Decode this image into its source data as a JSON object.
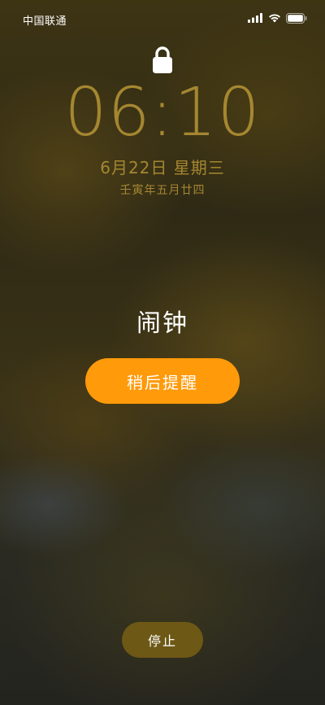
{
  "status_bar": {
    "carrier": "中国联通",
    "icons": [
      "signal-icon",
      "wifi-icon",
      "battery-icon"
    ]
  },
  "lock_screen": {
    "lock_icon": "lock-icon",
    "time": "06:10",
    "date": "6月22日 星期三",
    "lunar_date": "壬寅年五月廿四"
  },
  "alarm": {
    "title": "闹钟",
    "snooze_label": "稍后提醒",
    "stop_label": "停止"
  },
  "colors": {
    "accent": "#ff9a0a",
    "clock_text": "#a58731",
    "stop_button": "#785f14"
  }
}
